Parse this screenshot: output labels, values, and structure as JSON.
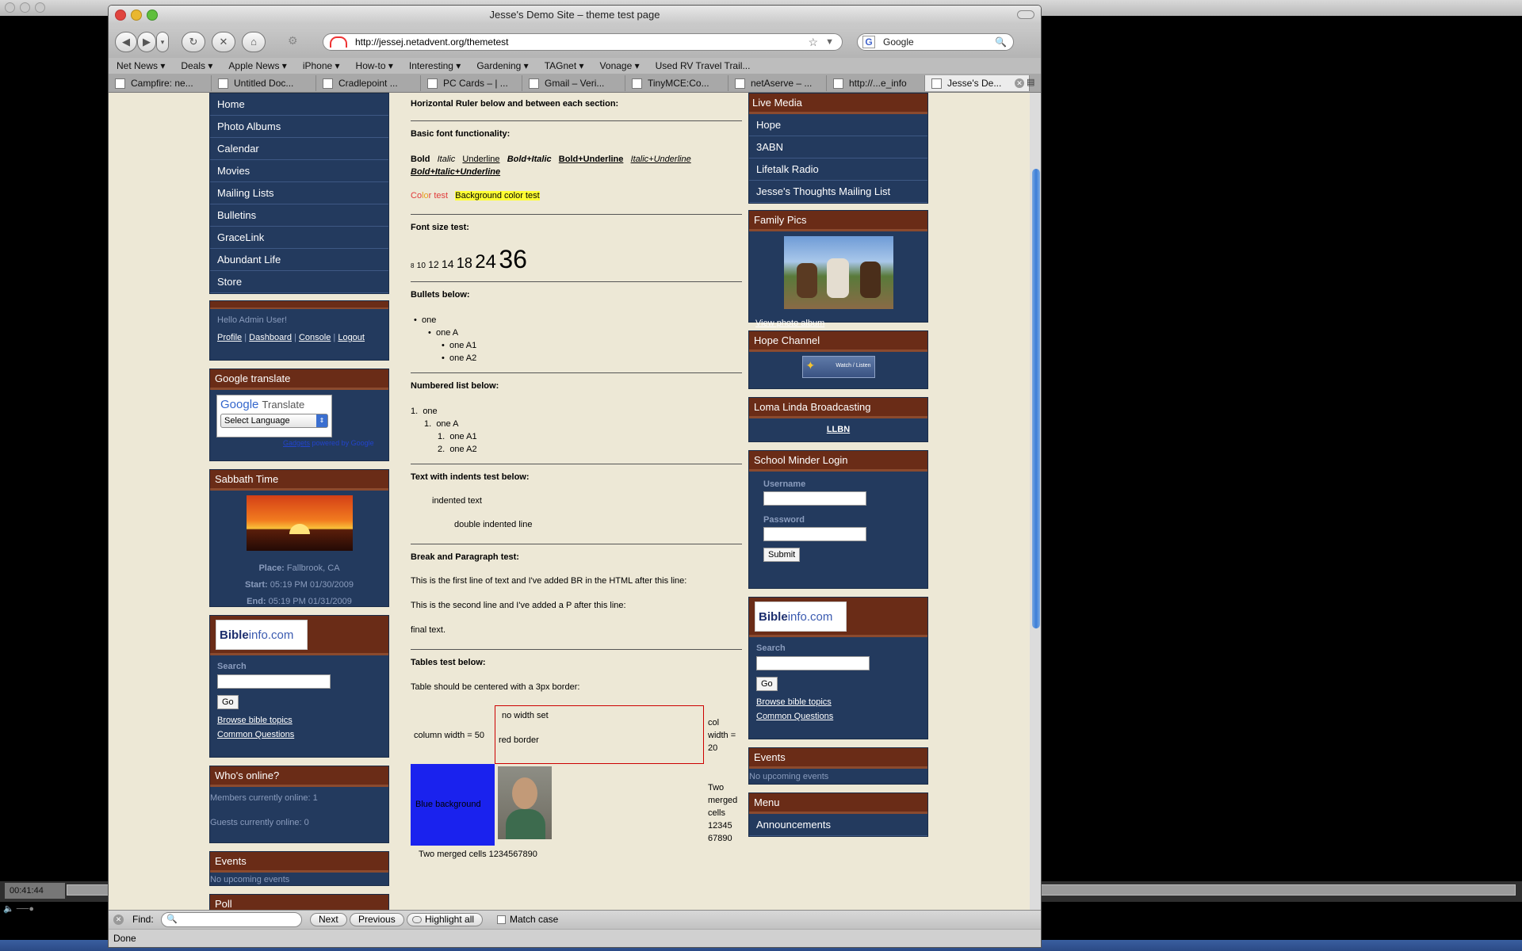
{
  "window": {
    "title": "Jesse's Demo Site – theme test page",
    "status": "Done"
  },
  "toolbar": {
    "back": "◀",
    "forward": "▶",
    "menu": "▾",
    "reload": "↻",
    "stop": "✕",
    "home": "⌂",
    "gear": "⚙",
    "url": "http://jessej.netadvent.org/themetest",
    "search_placeholder": "Google",
    "search_engine_glyph": "G"
  },
  "bookmarks": [
    "Net News ▾",
    "Deals ▾",
    "Apple News ▾",
    "iPhone ▾",
    "How-to ▾",
    "Interesting ▾",
    "Gardening ▾",
    "TAGnet ▾",
    "Vonage ▾",
    "Used RV Travel Trail..."
  ],
  "tabs": [
    "Campfire: ne...",
    "Untitled Doc...",
    "Cradlepoint ...",
    "PC Cards – | ...",
    "Gmail – Veri...",
    "TinyMCE:Co...",
    "netAserve – ...",
    "http://...e_info",
    "Jesse's De..."
  ],
  "findbar": {
    "label": "Find:",
    "next": "Next",
    "previous": "Previous",
    "highlight": "Highlight all",
    "match_case": "Match case"
  },
  "media": {
    "timecode": "00:41:44"
  },
  "left": {
    "nav": [
      "Home",
      "Photo Albums",
      "Calendar",
      "Movies",
      "Mailing Lists",
      "Bulletins",
      "GraceLink",
      "Abundant Life",
      "Store"
    ],
    "user": {
      "hello": "Hello Admin User!",
      "links": [
        "Profile",
        "Dashboard",
        "Console",
        "Logout"
      ],
      "sep": "|"
    },
    "translate": {
      "title": "Google translate",
      "google": "Google",
      "translate": "Translate",
      "select": "Select Language",
      "gadgets": "Gadgets",
      "powered": "powered by Google"
    },
    "sabbath": {
      "title": "Sabbath Time",
      "place_label": "Place:",
      "place": "Fallbrook, CA",
      "start_label": "Start:",
      "start": "05:19 PM 01/30/2009",
      "end_label": "End:",
      "end": "05:19 PM 01/31/2009"
    },
    "bibleinfo": {
      "logo_a": "Bible",
      "logo_b": "info.com",
      "search": "Search",
      "go": "Go",
      "links": [
        "Browse bible topics",
        "Common Questions"
      ]
    },
    "online": {
      "title": "Who's online?",
      "members": "Members currently online: 1",
      "guests": "Guests currently online: 0"
    },
    "events": {
      "title": "Events",
      "none": "No upcoming events"
    },
    "poll": {
      "title": "Poll"
    }
  },
  "main": {
    "hr_heading": "Horizontal Ruler below and between each section:",
    "font_heading": "Basic font functionality:",
    "font_samples": [
      "Bold",
      "Italic",
      "Underline",
      "Bold+Italic",
      "Bold+Underline",
      "Italic+Underline",
      "Bold+Italic+Underline"
    ],
    "color_text": [
      "Co",
      "lo",
      "r test"
    ],
    "bg_color_text": "Background color test",
    "size_heading": "Font size test:",
    "sizes": [
      "8",
      "10",
      "12",
      "14",
      "18",
      "24",
      "36"
    ],
    "bullets_heading": "Bullets below:",
    "bullets": [
      "one",
      "one A",
      "one A1",
      "one A2"
    ],
    "numbered_heading": "Numbered list below:",
    "numbered": [
      "one",
      "one A",
      "one A1",
      "one A2"
    ],
    "numbered_marks": [
      "1.",
      "1.",
      "1.",
      "2."
    ],
    "indent_heading": "Text with indents test below:",
    "indent1": "indented text",
    "indent2": "double indented line",
    "break_heading": "Break and Paragraph test:",
    "break1": "This is the first line of text and I've added BR in the HTML after this line:",
    "break2": "This is the second line and I've added a P after this line:",
    "break3": "final text.",
    "tables_heading": "Tables test below:",
    "tables_note": "Table should be centered with a 3px border:",
    "t_col50": "column width = 50",
    "t_nowidth": "no width set",
    "t_redborder": "red border",
    "t_col20": [
      "col",
      "width =",
      "20"
    ],
    "t_blue": "Blue background",
    "t_merged_right": [
      "Two",
      "merged",
      "cells",
      "12345",
      "67890"
    ],
    "t_merged_bottom": "Two merged cells 1234567890"
  },
  "right": {
    "live": {
      "title": "Live Media",
      "items": [
        "Hope",
        "3ABN",
        "Lifetalk Radio",
        "Jesse's Thoughts Mailing List"
      ]
    },
    "family": {
      "title": "Family Pics",
      "link": "View photo album"
    },
    "hope": {
      "title": "Hope Channel",
      "badge": "Watch / Listen"
    },
    "llbn": {
      "title": "Loma Linda Broadcasting",
      "link": "LLBN"
    },
    "login": {
      "title": "School Minder Login",
      "username": "Username",
      "password": "Password",
      "submit": "Submit"
    },
    "bibleinfo": {
      "logo_a": "Bible",
      "logo_b": "info.com",
      "search": "Search",
      "go": "Go",
      "links": [
        "Browse bible topics",
        "Common Questions"
      ]
    },
    "events": {
      "title": "Events",
      "none": "No upcoming events"
    },
    "menu": {
      "title": "Menu",
      "items": [
        "Announcements"
      ]
    }
  }
}
